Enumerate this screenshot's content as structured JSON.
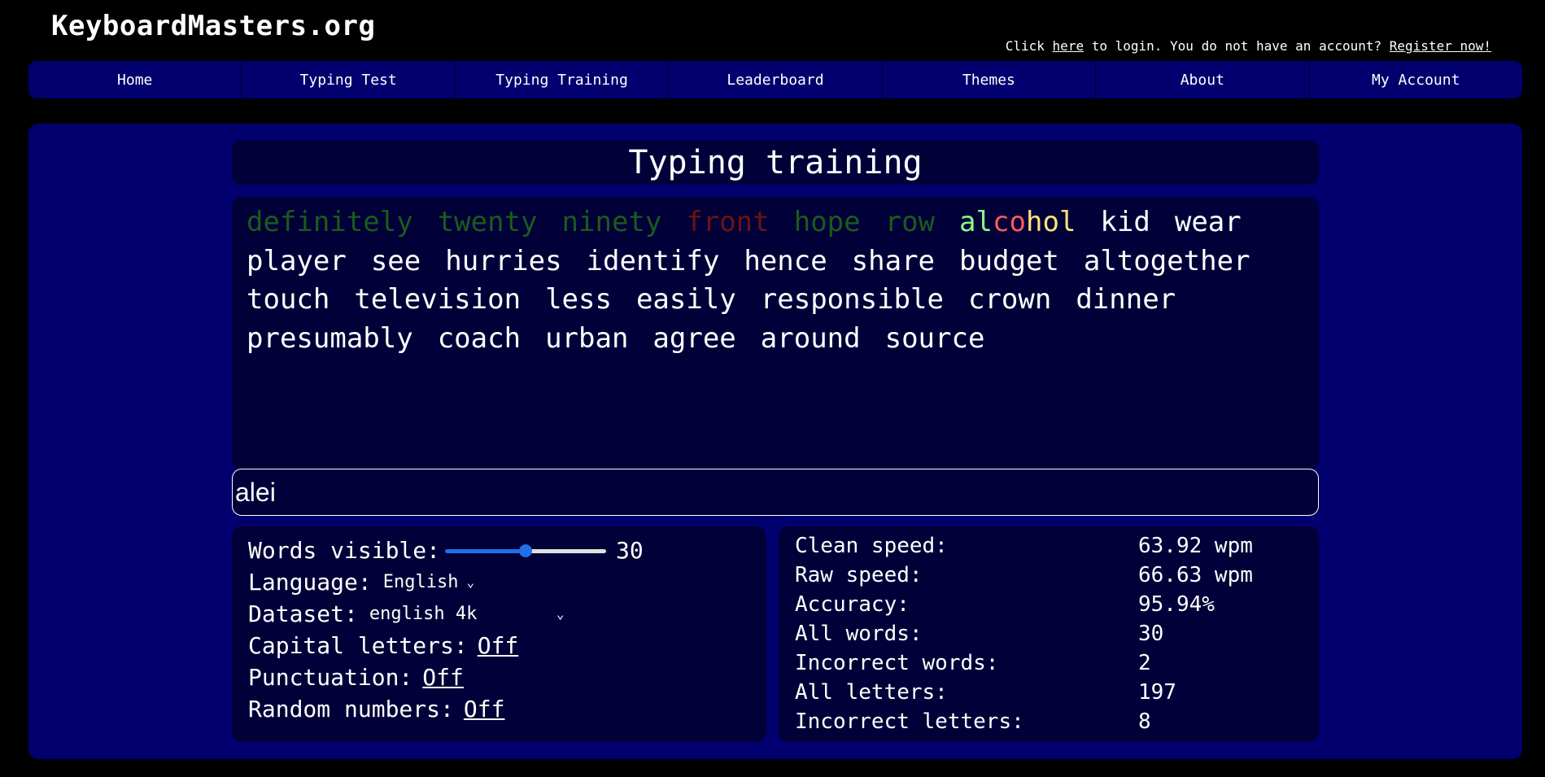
{
  "header": {
    "logo": "KeyboardMasters.org",
    "login_prefix": "Click ",
    "login_link": "here",
    "login_middle": " to login. You do not have an account? ",
    "register_link": "Register now!"
  },
  "nav": {
    "items": [
      "Home",
      "Typing Test",
      "Typing Training",
      "Leaderboard",
      "Themes",
      "About",
      "My Account"
    ]
  },
  "training": {
    "title": "Typing training",
    "done_words": [
      {
        "text": "definitely",
        "status": "correct"
      },
      {
        "text": "twenty",
        "status": "correct"
      },
      {
        "text": "ninety",
        "status": "correct"
      },
      {
        "text": "front",
        "status": "incorrect"
      },
      {
        "text": "hope",
        "status": "correct"
      },
      {
        "text": "row",
        "status": "correct"
      }
    ],
    "current_word": {
      "letters": [
        {
          "char": "a",
          "state": "ok"
        },
        {
          "char": "l",
          "state": "ok"
        },
        {
          "char": "c",
          "state": "bad"
        },
        {
          "char": "o",
          "state": "bad"
        },
        {
          "char": "h",
          "state": "pending"
        },
        {
          "char": "o",
          "state": "pending"
        },
        {
          "char": "l",
          "state": "pending"
        }
      ]
    },
    "remaining_words": [
      "kid",
      "wear",
      "player",
      "see",
      "hurries",
      "identify",
      "hence",
      "share",
      "budget",
      "altogether",
      "touch",
      "television",
      "less",
      "easily",
      "responsible",
      "crown",
      "dinner",
      "presumably",
      "coach",
      "urban",
      "agree",
      "around",
      "source"
    ],
    "input_value": "alei"
  },
  "settings": {
    "words_visible_label": "Words visible:",
    "words_visible_value": "30",
    "words_visible_fraction": 0.5,
    "language_label": "Language:",
    "language_value": "English",
    "dataset_label": "Dataset:",
    "dataset_value": "english 4k",
    "capital_label": "Capital letters:",
    "capital_value": "Off",
    "punctuation_label": "Punctuation:",
    "punctuation_value": "Off",
    "numbers_label": "Random numbers:",
    "numbers_value": "Off"
  },
  "stats": [
    {
      "label": "Clean speed:",
      "value": "63.92 wpm"
    },
    {
      "label": "Raw speed:",
      "value": "66.63 wpm"
    },
    {
      "label": "Accuracy:",
      "value": "95.94%"
    },
    {
      "label": "All words:",
      "value": "30"
    },
    {
      "label": "Incorrect words:",
      "value": "2"
    },
    {
      "label": "All letters:",
      "value": "197"
    },
    {
      "label": "Incorrect letters:",
      "value": "8"
    }
  ],
  "colors": {
    "background": "#000000",
    "panel": "#02006e",
    "inner_panel": "#010038",
    "correct_word": "#1b5b1b",
    "incorrect_word": "#6b1414",
    "letter_ok": "#88ff88",
    "letter_bad": "#ff5a5a",
    "letter_pending": "#ffe27a",
    "slider_accent": "#1e6fe8"
  }
}
